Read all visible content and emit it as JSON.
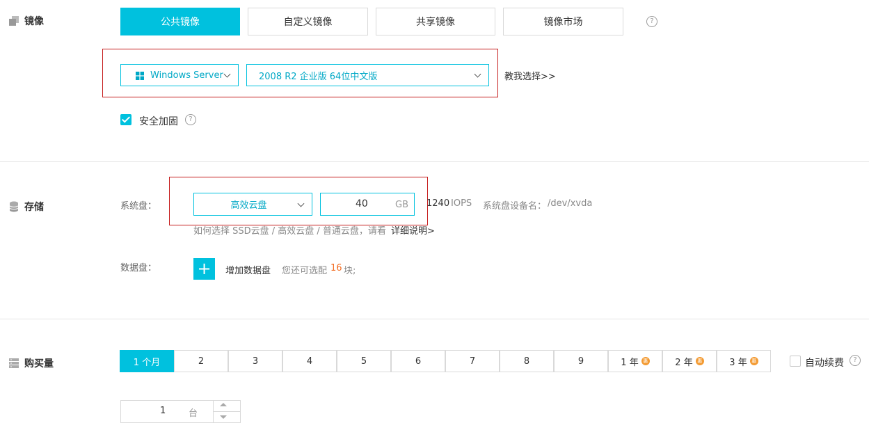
{
  "image_section": {
    "title": "镜像",
    "tabs": [
      "公共镜像",
      "自定义镜像",
      "共享镜像",
      "镜像市场"
    ],
    "active_tab": "公共镜像",
    "os_select": "Windows Server",
    "version_select": "2008 R2 企业版 64位中文版",
    "help_link": "教我选择>>",
    "security_label": "安全加固",
    "security_checked": true
  },
  "storage_section": {
    "title": "存储",
    "system_disk_label": "系统盘：",
    "disk_type": "高效云盘",
    "disk_size": "40",
    "disk_unit": "GB",
    "iops_value": "1240",
    "iops_unit": "IOPS",
    "device_name_label": "系统盘设备名：",
    "device_name": "/dev/xvda",
    "disk_hint": "如何选择 SSD云盘 / 高效云盘 / 普通云盘，请看",
    "disk_hint_link": "详细说明>",
    "data_disk_label": "数据盘：",
    "add_data_disk_label": "增加数据盘",
    "remaining_prefix": "您还可选配",
    "remaining_count": "16",
    "remaining_suffix": "块;"
  },
  "purchase_section": {
    "title": "购买量",
    "durations": [
      "1 个月",
      "2",
      "3",
      "4",
      "5",
      "6",
      "7",
      "8",
      "9",
      "1 年",
      "2 年",
      "3 年"
    ],
    "active_duration": "1 个月",
    "discount_badge": "惠",
    "auto_renew_label": "自动续费",
    "auto_renew_checked": false,
    "quantity": "1",
    "quantity_unit": "台"
  },
  "colors": {
    "accent": "#00c1de",
    "highlight_box": "#c51b1b",
    "count_highlight": "#f36c21",
    "badge": "#f39a32"
  }
}
